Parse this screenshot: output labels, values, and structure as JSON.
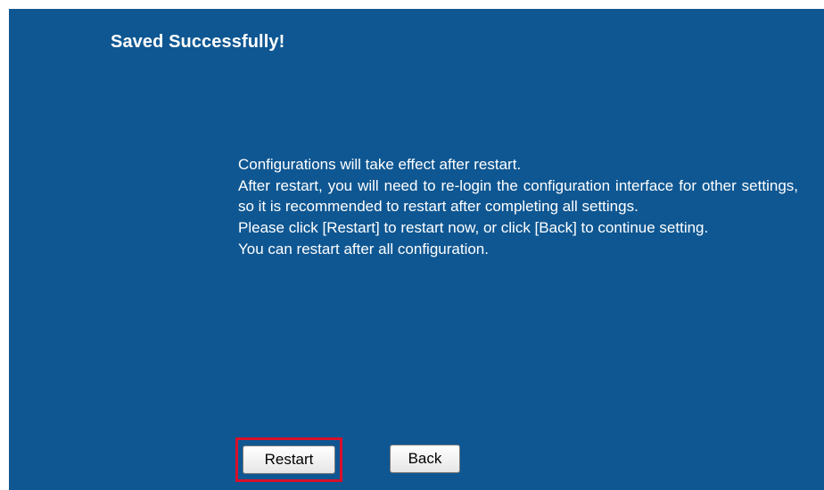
{
  "colors": {
    "panel_background": "#0f5792",
    "text": "#ffffff",
    "highlight_border": "#d8102a"
  },
  "title": "Saved Successfully!",
  "message_lines": [
    "Configurations will take effect after restart.",
    "After restart, you will need to re-login the configuration interface for other settings, so it is recommended to restart after completing all settings.",
    "Please click [Restart] to restart now, or click [Back] to continue setting.",
    "You can restart after all configuration."
  ],
  "buttons": {
    "restart_label": "Restart",
    "back_label": "Back"
  }
}
